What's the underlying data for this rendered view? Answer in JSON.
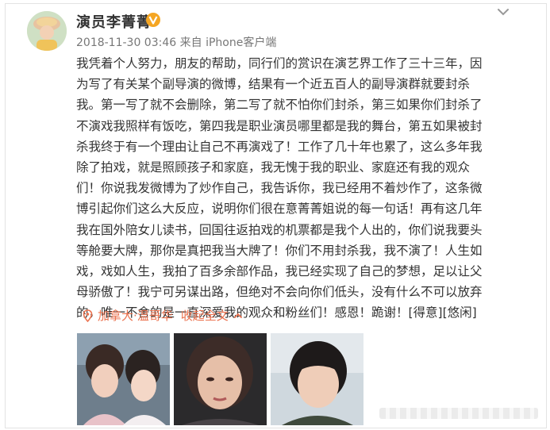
{
  "user": {
    "name": "演员李菁菁",
    "timestamp": "2018-11-30 03:46",
    "source": "来自 iPhone客户端"
  },
  "post": {
    "lines": [
      "我凭着个人努力，朋友的帮助，同行们的赏识在演艺界工作了三十三年，因",
      "为写了有关某个副导演的微博，结果有一个近五百人的副导演群就要封杀",
      "我。第一写了就不会删除，第二写了就不怕你们封杀，第三如果你们封杀了",
      "不演戏我照样有饭吃，第四我是职业演员哪里都是我的舞台，第五如果被封",
      "杀我终于有一个理由让自己不再演戏了！工作了几十年也累了，这么多年我",
      "除了拍戏，就是照顾孩子和家庭，我无愧于我的职业、家庭还有我的观众",
      "们！你说我发微博为了炒作自己，我告诉你，我已经用不着炒作了，这条微",
      "博引起你们这么大反应，说明你们很在意菁菁姐说的每一句话！再有这几年",
      "我在国外陪女儿读书，回国往返拍戏的机票都是我个人出的，你们说我要头",
      "等舱要大牌，那你是真把我当大牌了！你们不用封杀我，我不演了！人生如",
      "戏，戏如人生，我拍了百多余部作品，我已经实现了自己的梦想，足以让父",
      "母骄傲了！我宁可另谋出路，但绝对不会向你们低头，没有什么不可以放弃",
      "的，唯一不舍的是一直深爱我的观众和粉丝们！感恩！跪谢！[得意][悠闲]"
    ]
  },
  "location": {
    "place": "加拿大·温哥华",
    "expand_label": "收起全文"
  },
  "colors": {
    "accent": "#eb7350",
    "verified_badge": "#f5a623",
    "text": "#333333",
    "meta": "#777777"
  },
  "icons": [
    "avatar",
    "verified-badge-icon",
    "chevron-down-icon",
    "location-pin-icon",
    "collapse-chevron-icon"
  ]
}
